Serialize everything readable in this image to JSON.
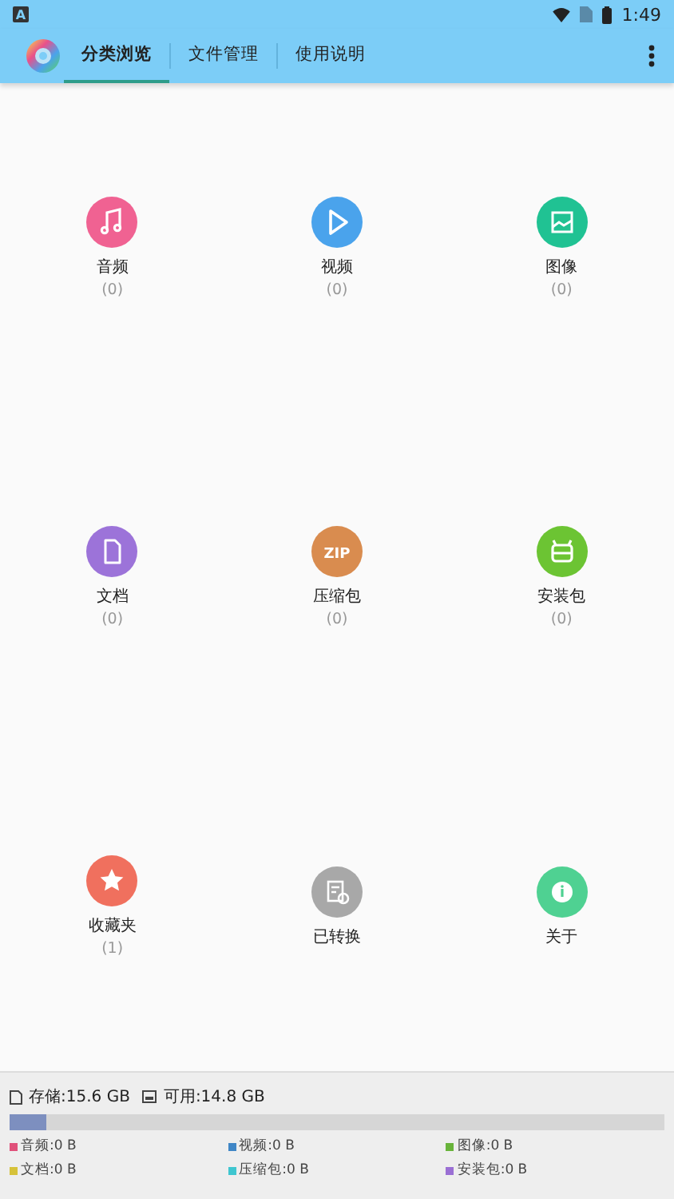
{
  "status_bar": {
    "notification": "A",
    "time": "1:49"
  },
  "toolbar": {
    "tabs": [
      {
        "label": "分类浏览",
        "selected": true
      },
      {
        "label": "文件管理",
        "selected": false
      },
      {
        "label": "使用说明",
        "selected": false
      }
    ]
  },
  "categories": [
    {
      "kind": "music",
      "label": "音频",
      "count": "(0)",
      "color": "#f06292"
    },
    {
      "kind": "video",
      "label": "视频",
      "count": "(0)",
      "color": "#4aa3ec"
    },
    {
      "kind": "image",
      "label": "图像",
      "count": "(0)",
      "color": "#20c293"
    },
    {
      "kind": "document",
      "label": "文档",
      "count": "(0)",
      "color": "#9c73d9"
    },
    {
      "kind": "zip",
      "label": "压缩包",
      "count": "(0)",
      "color": "#d98c4f",
      "icon_text": "ZIP"
    },
    {
      "kind": "package",
      "label": "安装包",
      "count": "(0)",
      "color": "#6cc433"
    },
    {
      "kind": "star",
      "label": "收藏夹",
      "count": "(1)",
      "color": "#f0705e"
    },
    {
      "kind": "converted",
      "label": "已转换",
      "color": "#a8a8a8"
    },
    {
      "kind": "about",
      "label": "关于",
      "color": "#4fd192"
    }
  ],
  "storage": {
    "total": "存储:15.6 GB",
    "available": "可用:14.8 GB",
    "level": 0.055,
    "legend": [
      {
        "label": "音频:0 B",
        "color": "#e0507a"
      },
      {
        "label": "视频:0 B",
        "color": "#3f86c6"
      },
      {
        "label": "图像:0 B",
        "color": "#68b33a"
      },
      {
        "label": "文档:0 B",
        "color": "#d6c23a"
      },
      {
        "label": "压缩包:0 B",
        "color": "#3fc6d0"
      },
      {
        "label": "安装包:0 B",
        "color": "#9a6fd4"
      }
    ]
  }
}
